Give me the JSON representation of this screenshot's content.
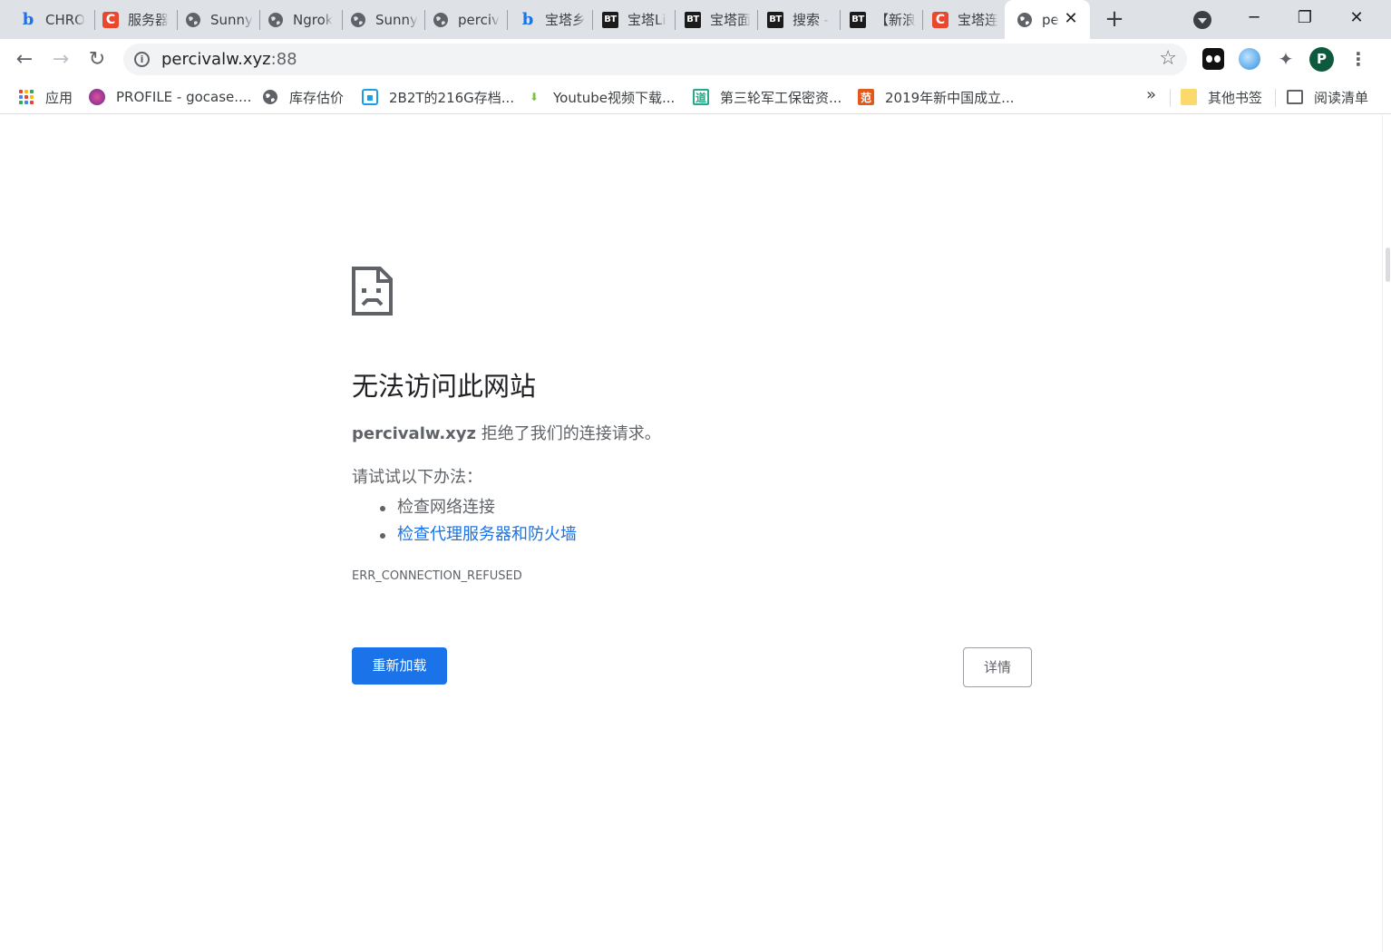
{
  "tabs": [
    {
      "title": "CHRO",
      "icon": "bing-icon"
    },
    {
      "title": "服务器",
      "icon": "csdn-icon"
    },
    {
      "title": "Sunny",
      "icon": "globe-icon"
    },
    {
      "title": "Ngrok",
      "icon": "globe-icon"
    },
    {
      "title": "Sunny",
      "icon": "globe-icon"
    },
    {
      "title": "perciv",
      "icon": "globe-icon"
    },
    {
      "title": "宝塔乡",
      "icon": "bing-icon"
    },
    {
      "title": "宝塔Li",
      "icon": "bt-icon"
    },
    {
      "title": "宝塔面",
      "icon": "bt-icon"
    },
    {
      "title": "搜索 -",
      "icon": "bt-icon"
    },
    {
      "title": "【新浪",
      "icon": "bt-icon"
    },
    {
      "title": "宝塔连",
      "icon": "csdn-icon"
    },
    {
      "title": "pe",
      "icon": "globe-icon",
      "active": true
    }
  ],
  "address": {
    "host": "percivalw.xyz",
    "port": ":88"
  },
  "profile_initial": "P",
  "bookmarks": {
    "items": [
      {
        "label": "应用",
        "icon": "apps-icon"
      },
      {
        "label": "PROFILE - gocase....",
        "icon": "profile-icon"
      },
      {
        "label": "库存估价",
        "icon": "globe-icon"
      },
      {
        "label": "2B2T的216G存档...",
        "icon": "bilibili-icon"
      },
      {
        "label": "Youtube视频下载...",
        "icon": "download-icon"
      },
      {
        "label": "第三轮军工保密资...",
        "icon": "doc-icon"
      },
      {
        "label": "2019年新中国成立...",
        "icon": "fan-icon"
      }
    ],
    "more": "»",
    "other_label": "其他书签",
    "reading_list_label": "阅读清单"
  },
  "error": {
    "title": "无法访问此网站",
    "host": "percivalw.xyz",
    "desc_suffix": " 拒绝了我们的连接请求。",
    "suggest_heading": "请试试以下办法：",
    "suggestions": [
      "检查网络连接",
      "检查代理服务器和防火墙"
    ],
    "code": "ERR_CONNECTION_REFUSED",
    "reload_label": "重新加载",
    "details_label": "详情"
  },
  "icons": {
    "bing_glyph": "b",
    "csdn_glyph": "C",
    "bt_glyph": "BT",
    "bilibili_glyph": "▪",
    "download_glyph": "⬇",
    "doc_glyph": "道",
    "fan_glyph": "范"
  },
  "colors": {
    "accent": "#1a73e8",
    "tabstrip": "#dee1e6",
    "text_secondary": "#5f6368"
  }
}
